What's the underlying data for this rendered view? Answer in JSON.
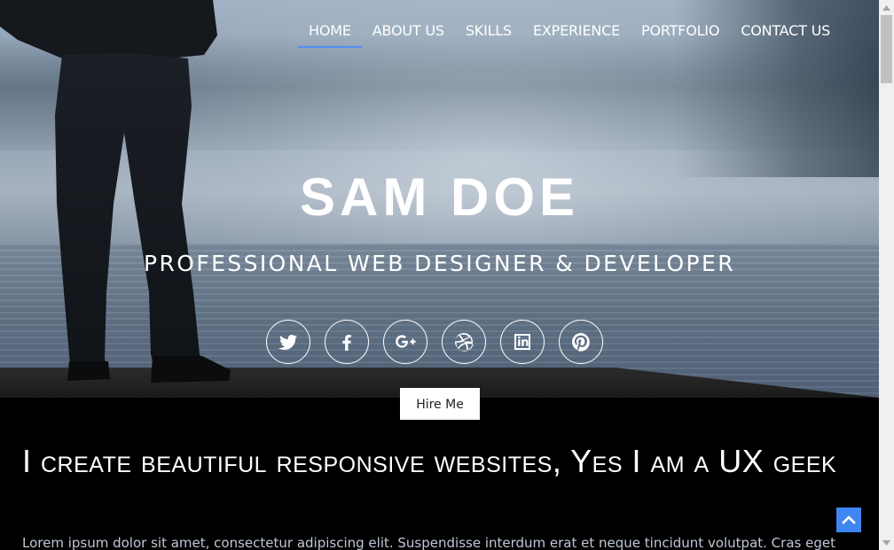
{
  "nav": {
    "items": [
      {
        "label": "HOME",
        "active": true
      },
      {
        "label": "ABOUT US",
        "active": false
      },
      {
        "label": "SKILLS",
        "active": false
      },
      {
        "label": "EXPERIENCE",
        "active": false
      },
      {
        "label": "PORTFOLIO",
        "active": false
      },
      {
        "label": "CONTACT US",
        "active": false
      }
    ],
    "active_color": "#4f8ff7"
  },
  "hero": {
    "name": "SAM DOE",
    "subtitle": "PROFESSIONAL WEB DESIGNER & DEVELOPER",
    "socials": [
      "twitter-icon",
      "facebook-icon",
      "google-plus-icon",
      "dribbble-icon",
      "linkedin-icon",
      "pinterest-icon"
    ],
    "hire_label": "Hire Me"
  },
  "about": {
    "headline": "I create beautiful responsive websites, Yes I am a UX geek",
    "body": "Lorem ipsum dolor sit amet, consectetur adipiscing elit. Suspendisse interdum erat et neque tincidunt volutpat. Cras eget"
  },
  "colors": {
    "accent": "#3f86f2",
    "page_bg": "#000000"
  }
}
